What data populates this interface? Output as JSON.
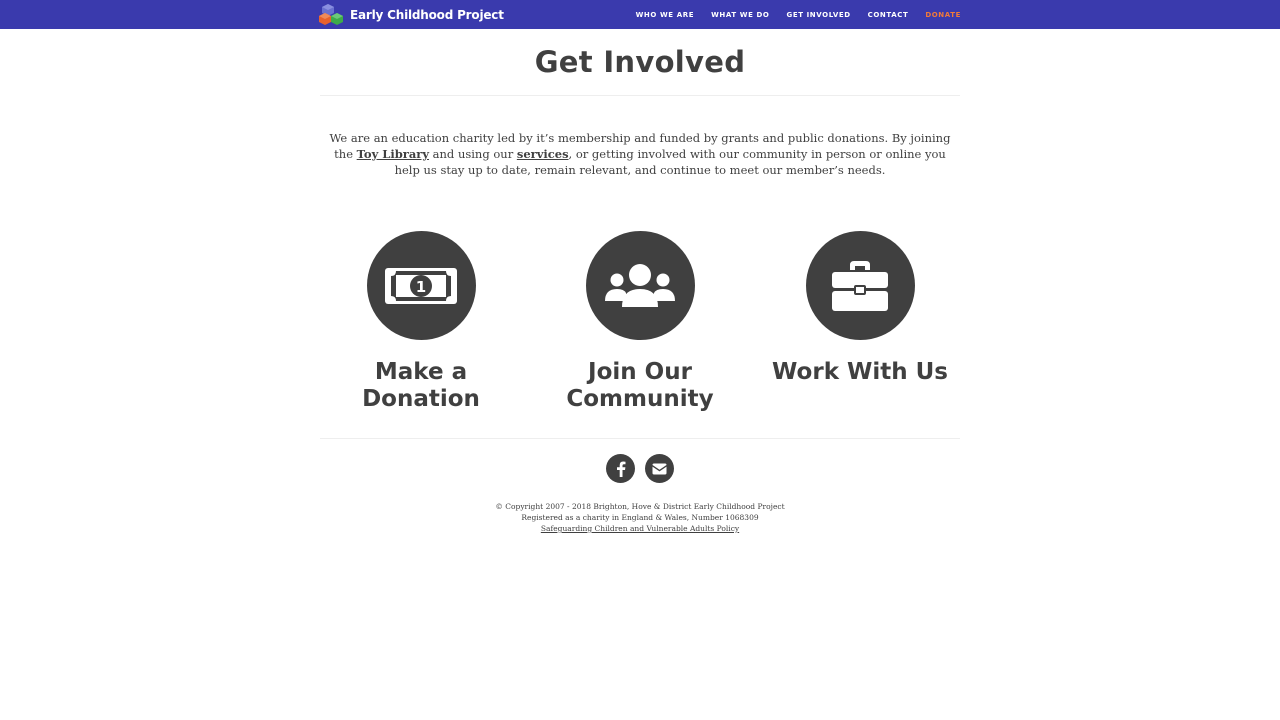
{
  "header": {
    "brand_name": "Early Childhood Project",
    "brand_colors": [
      "#5b63c9",
      "#e8612c",
      "#3dab4a"
    ],
    "nav": [
      {
        "label": "WHO WE ARE"
      },
      {
        "label": "WHAT WE DO"
      },
      {
        "label": "GET INVOLVED"
      },
      {
        "label": "CONTACT"
      },
      {
        "label": "DONATE",
        "color": "#f07a3a"
      }
    ],
    "background": "#3a3aad"
  },
  "main": {
    "title": "Get Involved",
    "intro": {
      "part1": "We are an education charity led by it’s membership and funded by grants and public donations. By joining the ",
      "link1": "Toy Library",
      "part2": " and using our ",
      "link2": "services",
      "part3": ", or getting involved with our community in person or online you help us stay up to date, remain relevant, and continue to meet our member’s needs."
    },
    "features": [
      {
        "icon": "money-bill-icon",
        "title": "Make a Donation"
      },
      {
        "icon": "users-icon",
        "title": "Join Our Community"
      },
      {
        "icon": "briefcase-icon",
        "title": "Work With Us"
      }
    ]
  },
  "footer": {
    "social": [
      {
        "icon": "facebook-icon"
      },
      {
        "icon": "envelope-icon"
      }
    ],
    "copyright": "© Copyright 2007 - 2018 Brighton, Hove & District Early Childhood Project",
    "charity": "Registered as a charity in England & Wales, Number 1068309",
    "policy_link": "Safeguarding Children and Vulnerable Adults Policy"
  },
  "colors": {
    "dark": "#404040",
    "accent": "#f07a3a"
  }
}
